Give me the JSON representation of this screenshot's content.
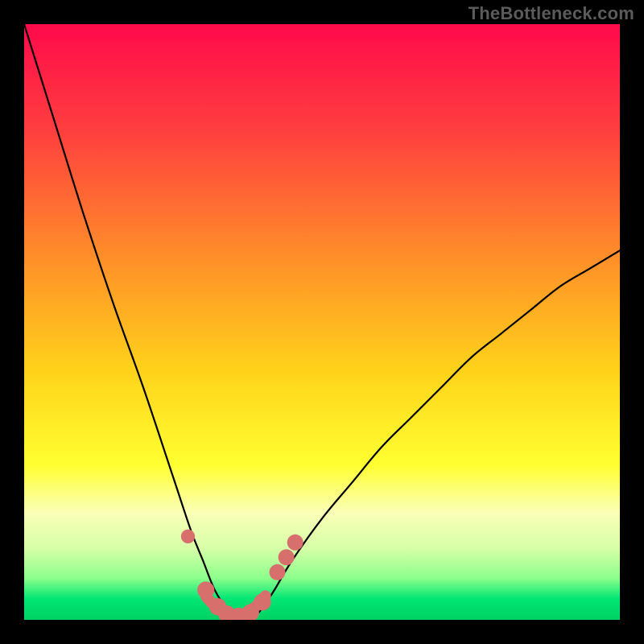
{
  "watermark": "TheBottleneck.com",
  "chart_data": {
    "type": "line",
    "title": "",
    "xlabel": "",
    "ylabel": "",
    "xlim": [
      0,
      100
    ],
    "ylim": [
      0,
      100
    ],
    "gradient_stops": [
      {
        "offset": 0.0,
        "color": "#ff0a4a"
      },
      {
        "offset": 0.18,
        "color": "#ff3f3f"
      },
      {
        "offset": 0.38,
        "color": "#ff8a2a"
      },
      {
        "offset": 0.58,
        "color": "#ffd21a"
      },
      {
        "offset": 0.74,
        "color": "#ffff30"
      },
      {
        "offset": 0.82,
        "color": "#faffb7"
      },
      {
        "offset": 0.88,
        "color": "#d6ffa8"
      },
      {
        "offset": 0.93,
        "color": "#8cff8c"
      },
      {
        "offset": 0.965,
        "color": "#00e673"
      },
      {
        "offset": 1.0,
        "color": "#00d162"
      }
    ],
    "series": [
      {
        "name": "bottleneck-curve",
        "x": [
          0,
          5,
          10,
          15,
          20,
          25,
          28,
          30,
          32,
          34,
          36,
          38,
          40,
          42,
          45,
          50,
          55,
          60,
          65,
          70,
          75,
          80,
          85,
          90,
          95,
          100
        ],
        "y": [
          100,
          84,
          68,
          53,
          39,
          24,
          15,
          10,
          5,
          2,
          0,
          0,
          2,
          5,
          10,
          17,
          23,
          29,
          34,
          39,
          44,
          48,
          52,
          56,
          59,
          62
        ]
      }
    ],
    "markers": [
      {
        "x": 27.5,
        "y": 14.0,
        "r": 1.3
      },
      {
        "x": 30.5,
        "y": 5.0,
        "r": 1.6
      },
      {
        "x": 32.5,
        "y": 2.2,
        "r": 1.6
      },
      {
        "x": 34.0,
        "y": 1.0,
        "r": 1.6
      },
      {
        "x": 36.0,
        "y": 0.6,
        "r": 1.6
      },
      {
        "x": 38.0,
        "y": 1.2,
        "r": 1.6
      },
      {
        "x": 40.0,
        "y": 3.0,
        "r": 1.6
      },
      {
        "x": 42.5,
        "y": 8.0,
        "r": 1.5
      },
      {
        "x": 44.0,
        "y": 10.5,
        "r": 1.5
      },
      {
        "x": 45.5,
        "y": 13.0,
        "r": 1.5
      }
    ],
    "bottom_arc": {
      "x0": 30.5,
      "x1": 40.5,
      "peak_y": 2.4
    }
  }
}
